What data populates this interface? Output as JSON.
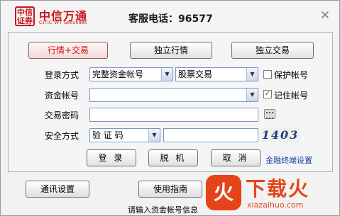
{
  "header": {
    "logo_text": "中信证券",
    "brand_name": "中信万通",
    "brand_english": "CITIC WT Securities",
    "hotline": "客服电话：96577",
    "close_glyph": "✕"
  },
  "mode_tabs": [
    {
      "label": "行情+交易",
      "active": true
    },
    {
      "label": "独立行情",
      "active": false
    },
    {
      "label": "独立交易",
      "active": false
    }
  ],
  "form": {
    "login_method_label": "登录方式",
    "login_method_value": "完整资金帐号",
    "trade_type_value": "股票交易",
    "protect_account_label": "保护帐号",
    "protect_account_checked": false,
    "account_label": "资金帐号",
    "account_value": "",
    "remember_account_label": "记住帐号",
    "remember_account_checked": true,
    "password_label": "交易密码",
    "password_value": "",
    "security_label": "安全方式",
    "security_value": "验 证 码",
    "captcha_input_value": "",
    "captcha_image_text": "1403",
    "keyboard_icon": "keyboard-icon",
    "dropdown_icon": "chevron-down-icon"
  },
  "actions": {
    "login_label": "登 录",
    "offline_label": "脱 机",
    "cancel_label": "取 消",
    "terminal_settings_link": "金融终端设置"
  },
  "footer": {
    "comm_settings_label": "通讯设置",
    "guide_label": "使用指南",
    "status_text": "请输入资金帐号信息"
  },
  "watermark": {
    "title": "下载火",
    "subtitle": "xiazaihuo.com",
    "logo_color": "#e64418"
  },
  "colors": {
    "brand_red": "#c8161d",
    "active_tab_text": "#d01010",
    "link_blue": "#1a3fa6"
  }
}
